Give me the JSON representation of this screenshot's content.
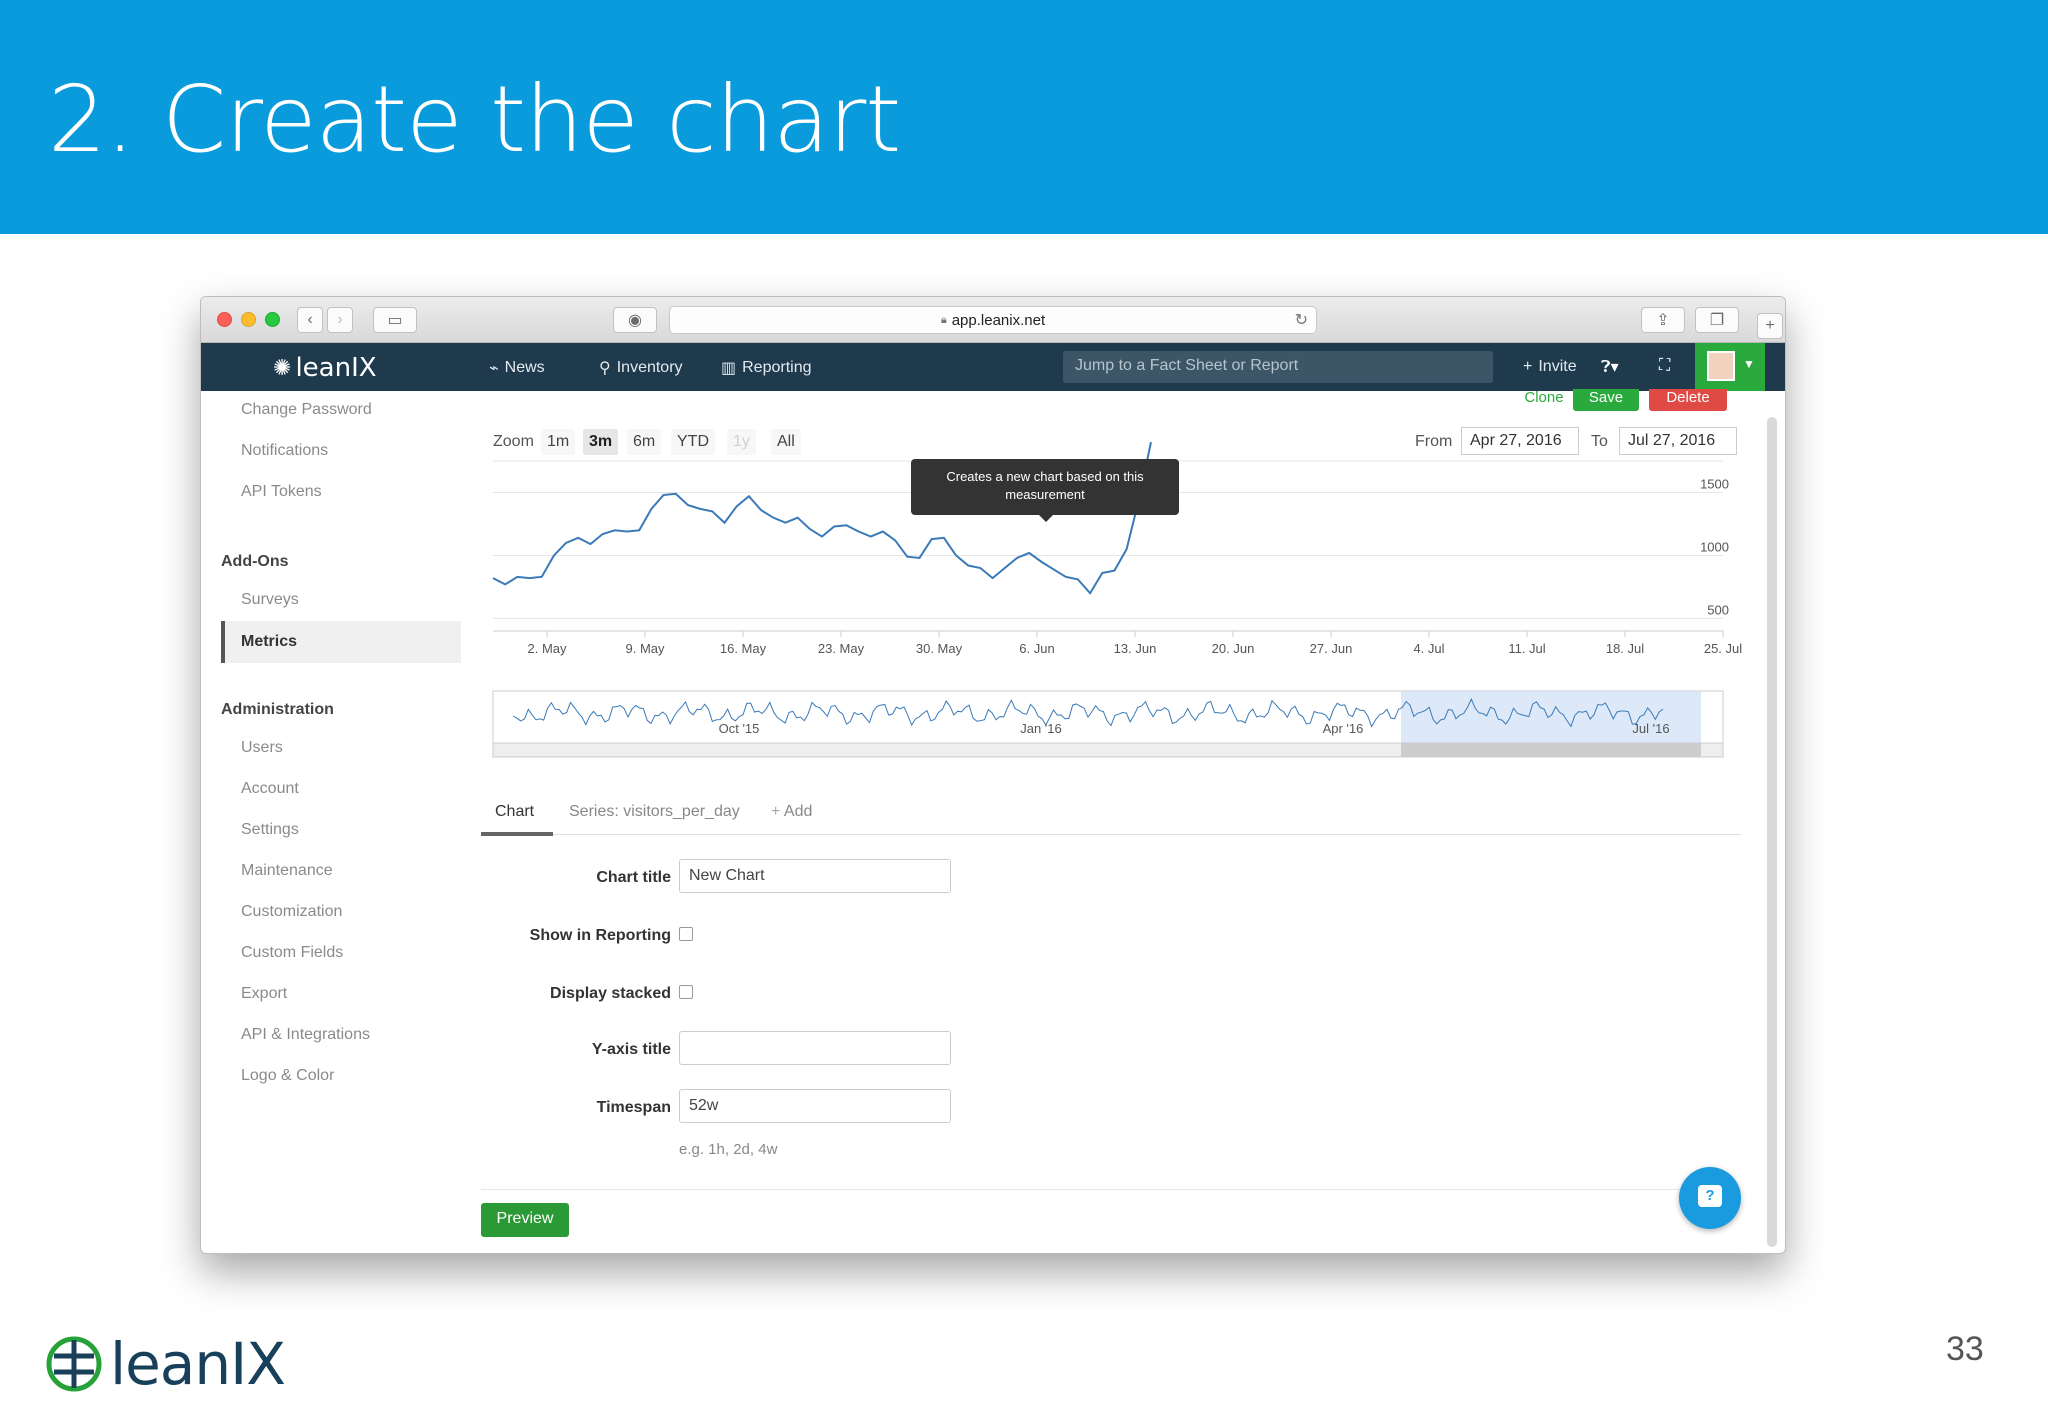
{
  "slide": {
    "title": "2. Create the chart",
    "page_number": "33"
  },
  "browser": {
    "url": "app.leanix.net"
  },
  "nav": {
    "logo": "leanIX",
    "links": [
      "News",
      "Inventory",
      "Reporting"
    ],
    "search_placeholder": "Jump to a Fact Sheet or Report",
    "invite": "Invite"
  },
  "sidebar": {
    "top_items": [
      "Change Password",
      "Notifications",
      "API Tokens"
    ],
    "addons_heading": "Add-Ons",
    "addons_items": [
      "Surveys",
      "Metrics"
    ],
    "admin_heading": "Administration",
    "admin_items": [
      "Users",
      "Account",
      "Settings",
      "Maintenance",
      "Customization",
      "Custom Fields",
      "Export",
      "API & Integrations",
      "Logo & Color"
    ]
  },
  "actions": {
    "clone": "Clone",
    "save": "Save",
    "delete": "Delete"
  },
  "zoom": {
    "label": "Zoom",
    "options": [
      "1m",
      "3m",
      "6m",
      "YTD",
      "1y",
      "All"
    ],
    "active": "3m"
  },
  "range": {
    "from_label": "From",
    "from": "Apr 27, 2016",
    "to_label": "To",
    "to": "Jul 27, 2016"
  },
  "tooltip": "Creates a new chart based on this measurement",
  "tabs": {
    "chart": "Chart",
    "series": "Series: visitors_per_day",
    "add": "Add"
  },
  "form": {
    "chart_title_label": "Chart title",
    "chart_title_value": "New Chart",
    "show_reporting_label": "Show in Reporting",
    "display_stacked_label": "Display stacked",
    "yaxis_label": "Y-axis title",
    "yaxis_value": "",
    "timespan_label": "Timespan",
    "timespan_value": "52w",
    "timespan_hint": "e.g. 1h, 2d, 4w",
    "preview": "Preview"
  },
  "colors": {
    "banner": "#0a9bdc",
    "nav": "#1f3a4d",
    "line": "#3a7ab8",
    "save": "#2aa93c",
    "delete": "#e04a45"
  },
  "chart_data": {
    "type": "line",
    "title": "",
    "x_ticks": [
      "2. May",
      "9. May",
      "16. May",
      "23. May",
      "30. May",
      "6. Jun",
      "13. Jun",
      "20. Jun",
      "27. Jun",
      "4. Jul",
      "11. Jul",
      "18. Jul",
      "25. Jul"
    ],
    "y_ticks": [
      500,
      1000,
      1500
    ],
    "ylim": [
      400,
      1750
    ],
    "navigator_ticks": [
      "Oct '15",
      "Jan '16",
      "Apr '16",
      "Jul '16"
    ],
    "series": [
      {
        "values": [
          820,
          770,
          830,
          820,
          830,
          1000,
          1100,
          1140,
          1090,
          1170,
          1200,
          1190,
          1200,
          1370,
          1480,
          1490,
          1400,
          1370,
          1350,
          1260,
          1390,
          1470,
          1360,
          1300,
          1260,
          1300,
          1210,
          1150,
          1230,
          1240,
          1190,
          1150,
          1190,
          1120,
          990,
          980,
          1130,
          1140,
          1000,
          920,
          900,
          820,
          900,
          980,
          1020,
          950,
          890,
          830,
          810,
          700,
          860,
          880,
          1050,
          1440,
          1900
        ]
      }
    ]
  }
}
